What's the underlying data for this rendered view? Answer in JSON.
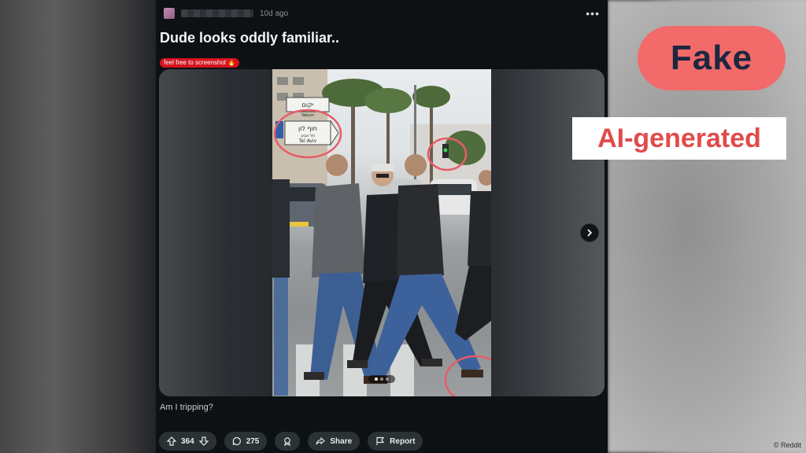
{
  "post": {
    "time_ago": "10d ago",
    "title": "Dude looks oddly familiar..",
    "flair": "feel free to screenshot 🔥",
    "caption": "Am I tripping?",
    "menu_icon": "more-dots-icon",
    "media": {
      "sign_hebrew_top": "יקום",
      "sign_latin_top": "Yakum",
      "sign_hebrew_main": "חוף לון",
      "sign_sub_hebrew": "תל אביב",
      "sign_latin_main": "Tel Aviv",
      "carousel_pages": 3,
      "carousel_active_index": 0
    },
    "actions": {
      "upvote_count": "364",
      "comment_count": "275",
      "share_label": "Share",
      "report_label": "Report"
    }
  },
  "overlay": {
    "badge_text": "Fake",
    "label_text": "AI-generated",
    "credit": "© Reddit",
    "colors": {
      "badge_bg": "#f26a6a",
      "badge_text": "#1c2740",
      "label_text": "#e14b4b"
    }
  }
}
